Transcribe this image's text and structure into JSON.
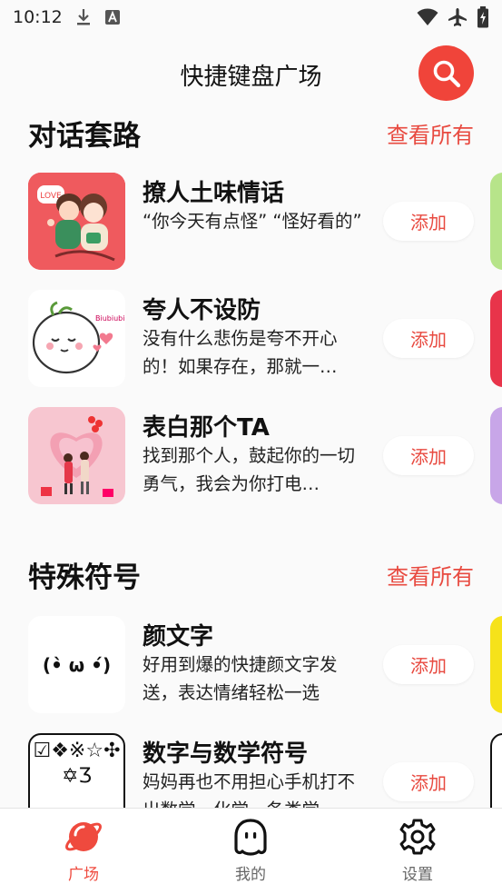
{
  "status_bar": {
    "time": "10:12",
    "icons": [
      "download-icon",
      "keyboard-a-icon",
      "wifi-icon",
      "airplane-icon",
      "battery-charging-icon"
    ]
  },
  "header": {
    "title": "快捷键盘广场",
    "search_icon": "search-icon",
    "accent_color": "#f0443a"
  },
  "sections": [
    {
      "title": "对话套路",
      "see_all": "查看所有",
      "items": [
        {
          "title": "撩人土味情话",
          "desc": "“你今天有点怪” “怪好看的”",
          "add": "添加",
          "thumb": "couple-illustration"
        },
        {
          "title": "夸人不设防",
          "desc": "没有什么悲伤是夸不开心的！如果存在，那就一…",
          "add": "添加",
          "thumb": "cute-bun-illustration"
        },
        {
          "title": "表白那个TA",
          "desc": "找到那个人，鼓起你的一切勇气，我会为你打电…",
          "add": "添加",
          "thumb": "confession-illustration"
        }
      ]
    },
    {
      "title": "特殊符号",
      "see_all": "查看所有",
      "items": [
        {
          "title": "颜文字",
          "desc": "好用到爆的快捷颜文字发送，表达情绪轻松一选",
          "add": "添加",
          "thumb_text": "(•̀ ω •́)"
        },
        {
          "title": "数字与数学符号",
          "desc": "妈妈再也不用担心手机打不出数学、化学、各类学…",
          "add": "添加",
          "thumb_text": "☑❖※☆✣✡Ʒ"
        }
      ]
    }
  ],
  "bottom_nav": [
    {
      "label": "广场",
      "icon": "planet-icon",
      "active": true
    },
    {
      "label": "我的",
      "icon": "ghost-icon",
      "active": false
    },
    {
      "label": "设置",
      "icon": "gear-icon",
      "active": false
    }
  ]
}
